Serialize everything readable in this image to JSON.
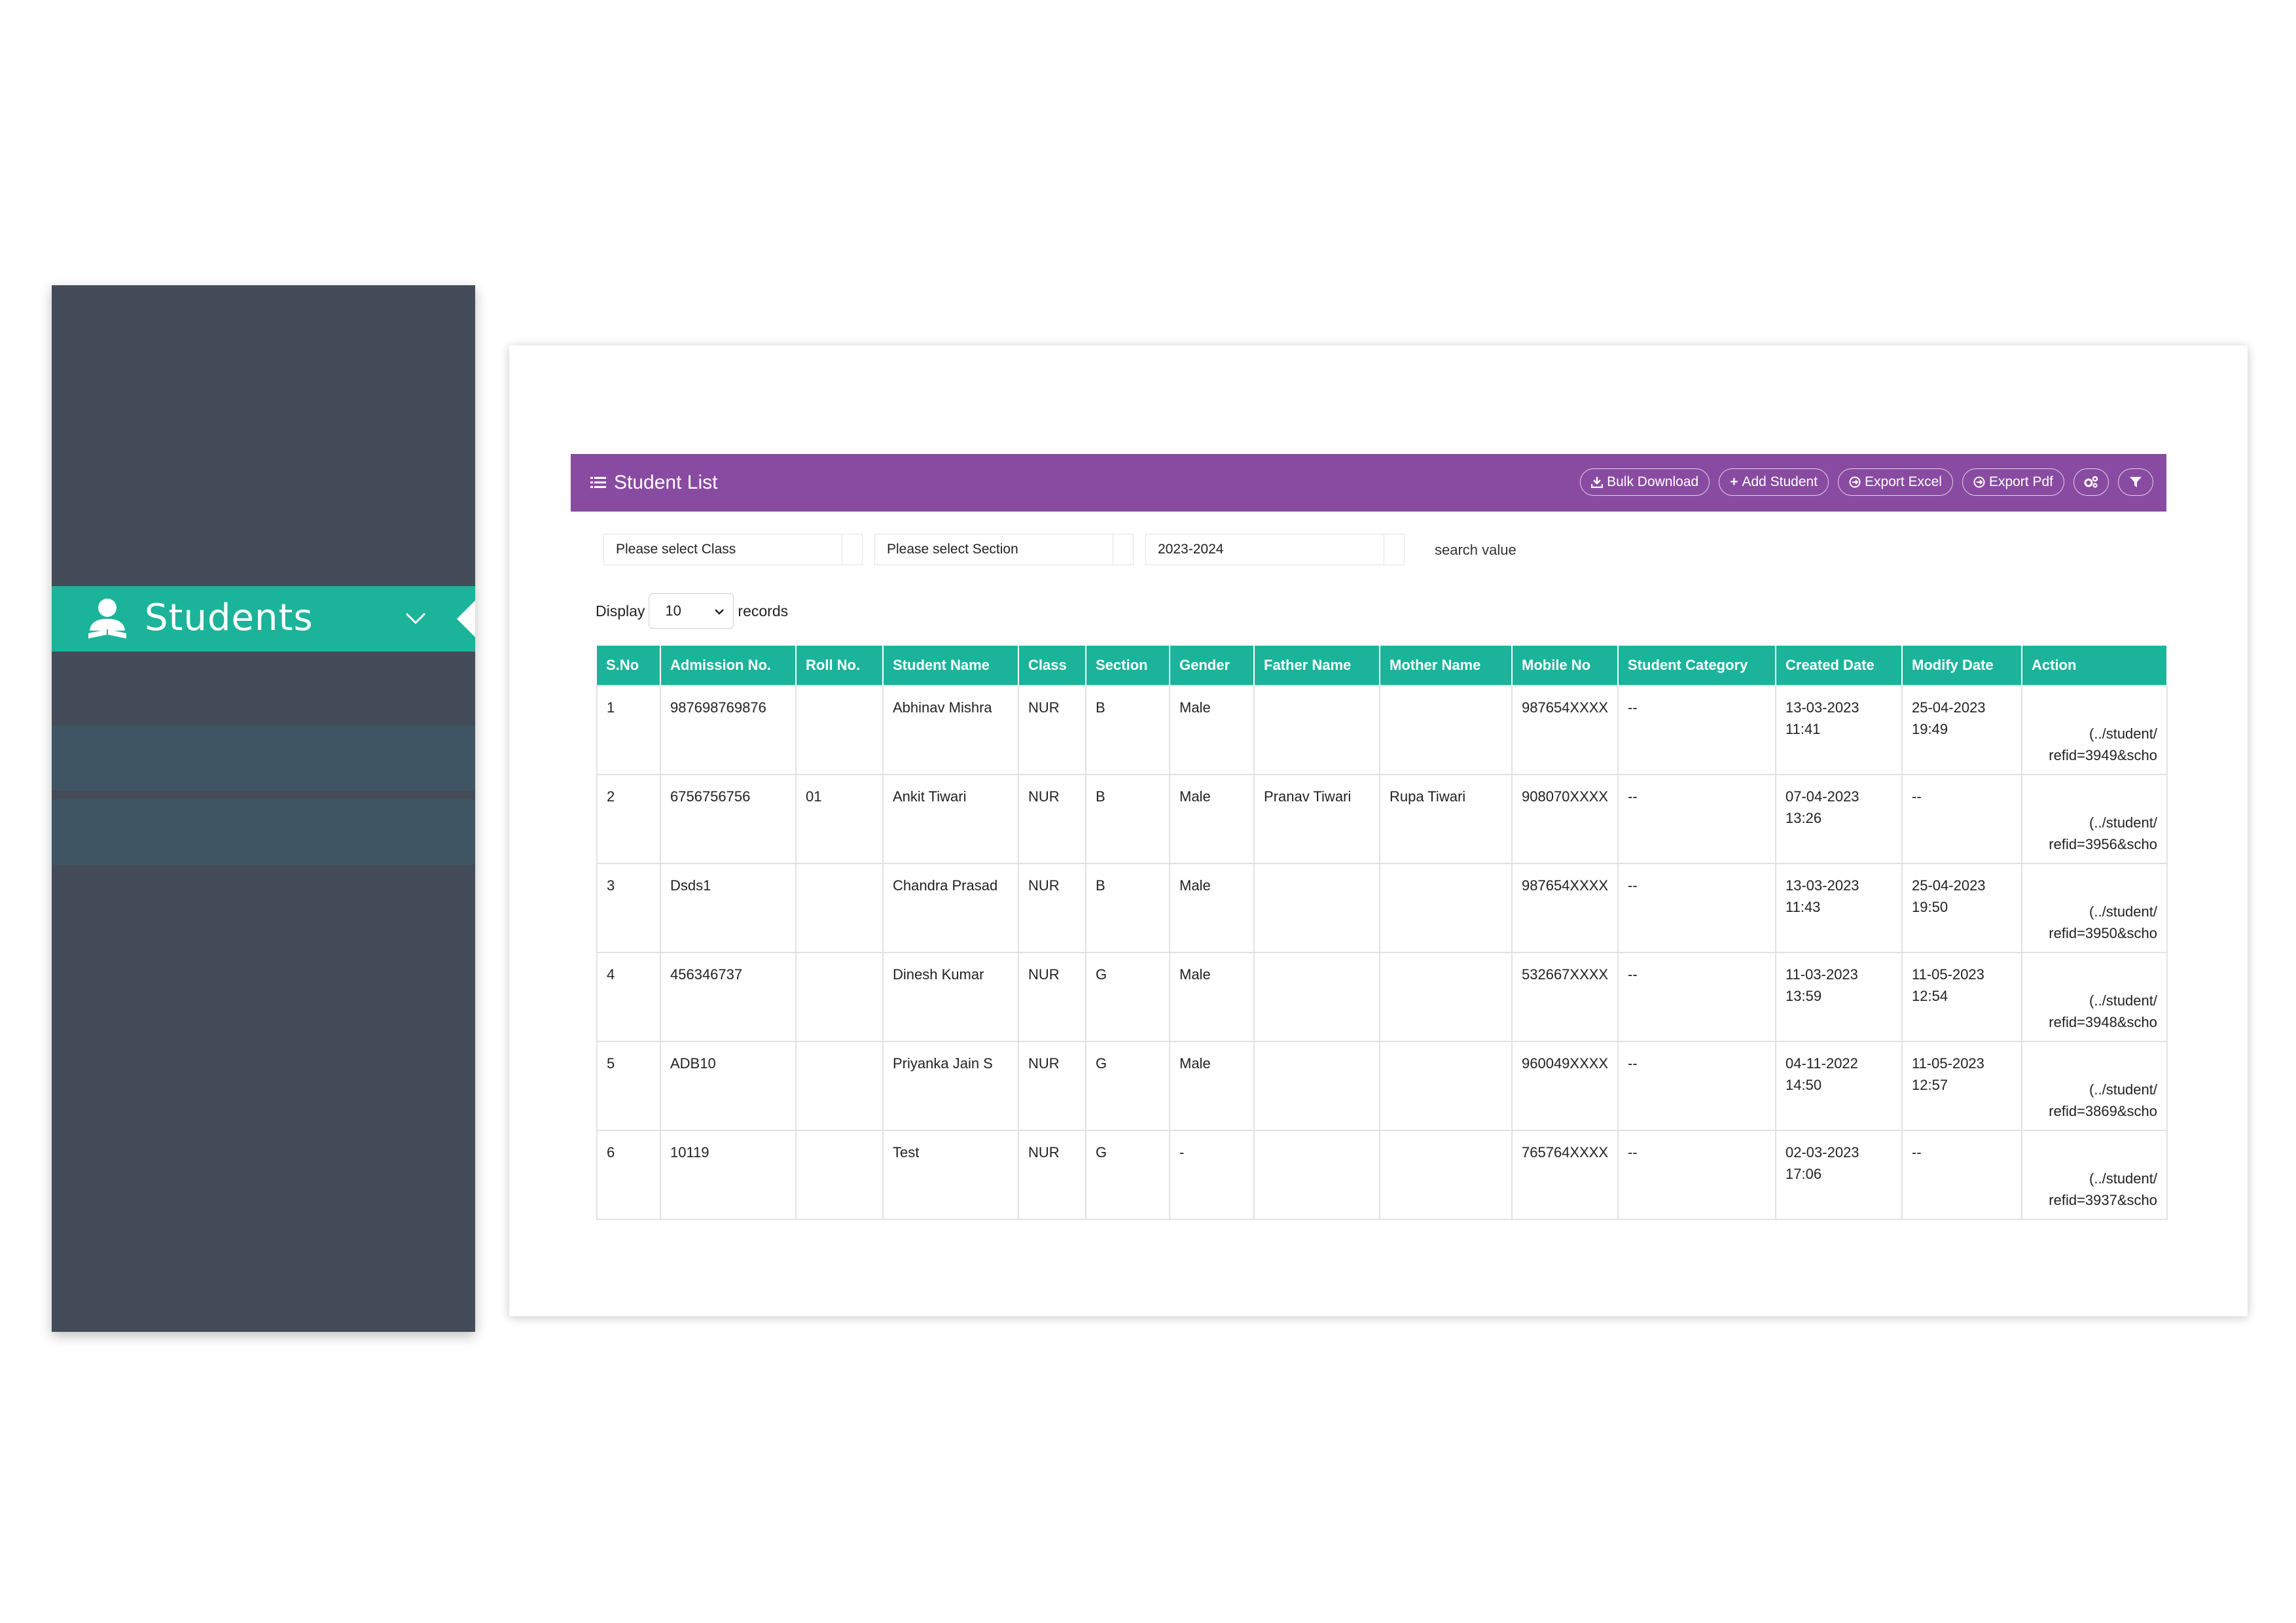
{
  "sidebar": {
    "active_item": {
      "label": "Students",
      "icon": "student-icon"
    }
  },
  "panel": {
    "title": "Student List",
    "buttons": {
      "bulk_download": "Bulk Download",
      "add_student": "Add Student",
      "export_excel": "Export Excel",
      "export_pdf": "Export Pdf"
    },
    "filters": {
      "class": "Please select Class",
      "section": "Please select Section",
      "session": "2023-2024",
      "search_label": "search value"
    },
    "display": {
      "label": "Display",
      "value": "10",
      "suffix": "records"
    }
  },
  "table": {
    "columns": [
      "S.No",
      "Admission No.",
      "Roll No.",
      "Student Name",
      "Class",
      "Section",
      "Gender",
      "Father Name",
      "Mother Name",
      "Mobile No",
      "Student Category",
      "Created Date",
      "Modify Date",
      "Action"
    ],
    "rows": [
      [
        "1",
        "987698769876",
        "",
        "Abhinav Mishra",
        "NUR",
        "B",
        "Male",
        "",
        "",
        "987654XXXX",
        "--",
        "13-03-2023\n11:41",
        "25-04-2023\n19:49",
        "(../student/\nrefid=3949&scho"
      ],
      [
        "2",
        "6756756756",
        "01",
        "Ankit Tiwari",
        "NUR",
        "B",
        "Male",
        "Pranav Tiwari",
        "Rupa Tiwari",
        "908070XXXX",
        "--",
        "07-04-2023\n13:26",
        "--",
        "(../student/\nrefid=3956&scho"
      ],
      [
        "3",
        "Dsds1",
        "",
        "Chandra Prasad",
        "NUR",
        "B",
        "Male",
        "",
        "",
        "987654XXXX",
        "--",
        "13-03-2023\n11:43",
        "25-04-2023\n19:50",
        "(../student/\nrefid=3950&scho"
      ],
      [
        "4",
        "456346737",
        "",
        "Dinesh Kumar",
        "NUR",
        "G",
        "Male",
        "",
        "",
        "532667XXXX",
        "--",
        "11-03-2023\n13:59",
        "11-05-2023\n12:54",
        "(../student/\nrefid=3948&scho"
      ],
      [
        "5",
        "ADB10",
        "",
        "Priyanka Jain S",
        "NUR",
        "G",
        "Male",
        "",
        "",
        "960049XXXX",
        "--",
        "04-11-2022\n14:50",
        "11-05-2023\n12:57",
        "(../student/\nrefid=3869&scho"
      ],
      [
        "6",
        "10119",
        "",
        "Test",
        "NUR",
        "G",
        "-",
        "",
        "",
        "765764XXXX",
        "--",
        "02-03-2023\n17:06",
        "--",
        "(../student/\nrefid=3937&scho"
      ]
    ]
  },
  "colors": {
    "sidebar": "#434c58",
    "accent": "#1bb49a",
    "header": "#894ba1",
    "submenu": "#3f5563"
  }
}
